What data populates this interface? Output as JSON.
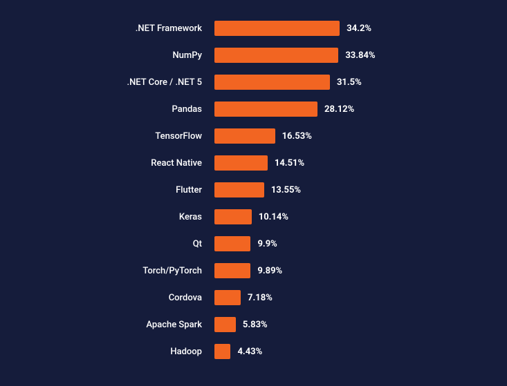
{
  "chart_data": {
    "type": "bar",
    "orientation": "horizontal",
    "title": "",
    "xlabel": "",
    "ylabel": "",
    "xlim": [
      0,
      100
    ],
    "categories": [
      ".NET Framework",
      "NumPy",
      ".NET Core / .NET 5",
      "Pandas",
      "TensorFlow",
      "React Native",
      "Flutter",
      "Keras",
      "Qt",
      "Torch/PyTorch",
      "Cordova",
      "Apache Spark",
      "Hadoop"
    ],
    "values": [
      34.2,
      33.84,
      31.5,
      28.12,
      16.53,
      14.51,
      13.55,
      10.14,
      9.9,
      9.89,
      7.18,
      5.83,
      4.43
    ],
    "value_labels": [
      "34.2%",
      "33.84%",
      "31.5%",
      "28.12%",
      "16.53%",
      "14.51%",
      "13.55%",
      "10.14%",
      "9.9%",
      "9.89%",
      "7.18%",
      "5.83%",
      "4.43%"
    ],
    "bar_color": "#f26522",
    "background_color": "#151c3b",
    "scale_factor": 5.3
  }
}
